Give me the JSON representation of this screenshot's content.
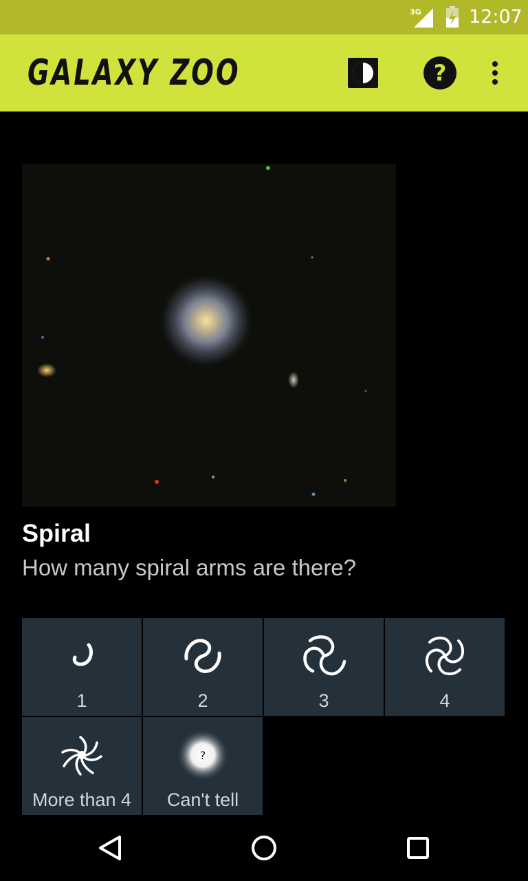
{
  "status_bar": {
    "network": "3G",
    "time": "12:07"
  },
  "app_bar": {
    "title": "GALAXY ZOO",
    "accent_color": "#d2e23c"
  },
  "question": {
    "title": "Spiral",
    "text": "How many spiral arms are there?"
  },
  "answers": [
    {
      "label": "1",
      "icon": "spiral-1-arm-icon"
    },
    {
      "label": "2",
      "icon": "spiral-2-arms-icon"
    },
    {
      "label": "3",
      "icon": "spiral-3-arms-icon"
    },
    {
      "label": "4",
      "icon": "spiral-4-arms-icon"
    },
    {
      "label": "More than 4",
      "icon": "spiral-many-arms-icon"
    },
    {
      "label": "Can't tell",
      "icon": "cant-tell-icon",
      "icon_text": "?"
    }
  ]
}
